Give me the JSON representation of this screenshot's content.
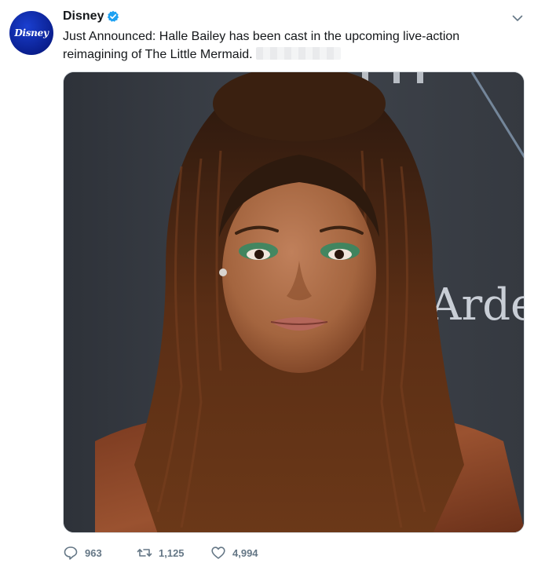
{
  "tweet": {
    "display_name": "Disney",
    "avatar_text": "Disney",
    "text": "Just Announced: Halle Bailey has been cast in the upcoming live-action reimagining of The Little Mermaid.",
    "media_text": "Arde",
    "actions": {
      "replies": "963",
      "retweets": "1,125",
      "likes": "4,994"
    }
  },
  "colors": {
    "brand": "#0a1f8f",
    "verified": "#1da1f2",
    "text": "#14171a",
    "muted": "#657786"
  },
  "icons": {
    "verified": "verified-badge-icon",
    "caret": "chevron-down-icon",
    "reply": "reply-icon",
    "retweet": "retweet-icon",
    "like": "heart-icon"
  }
}
